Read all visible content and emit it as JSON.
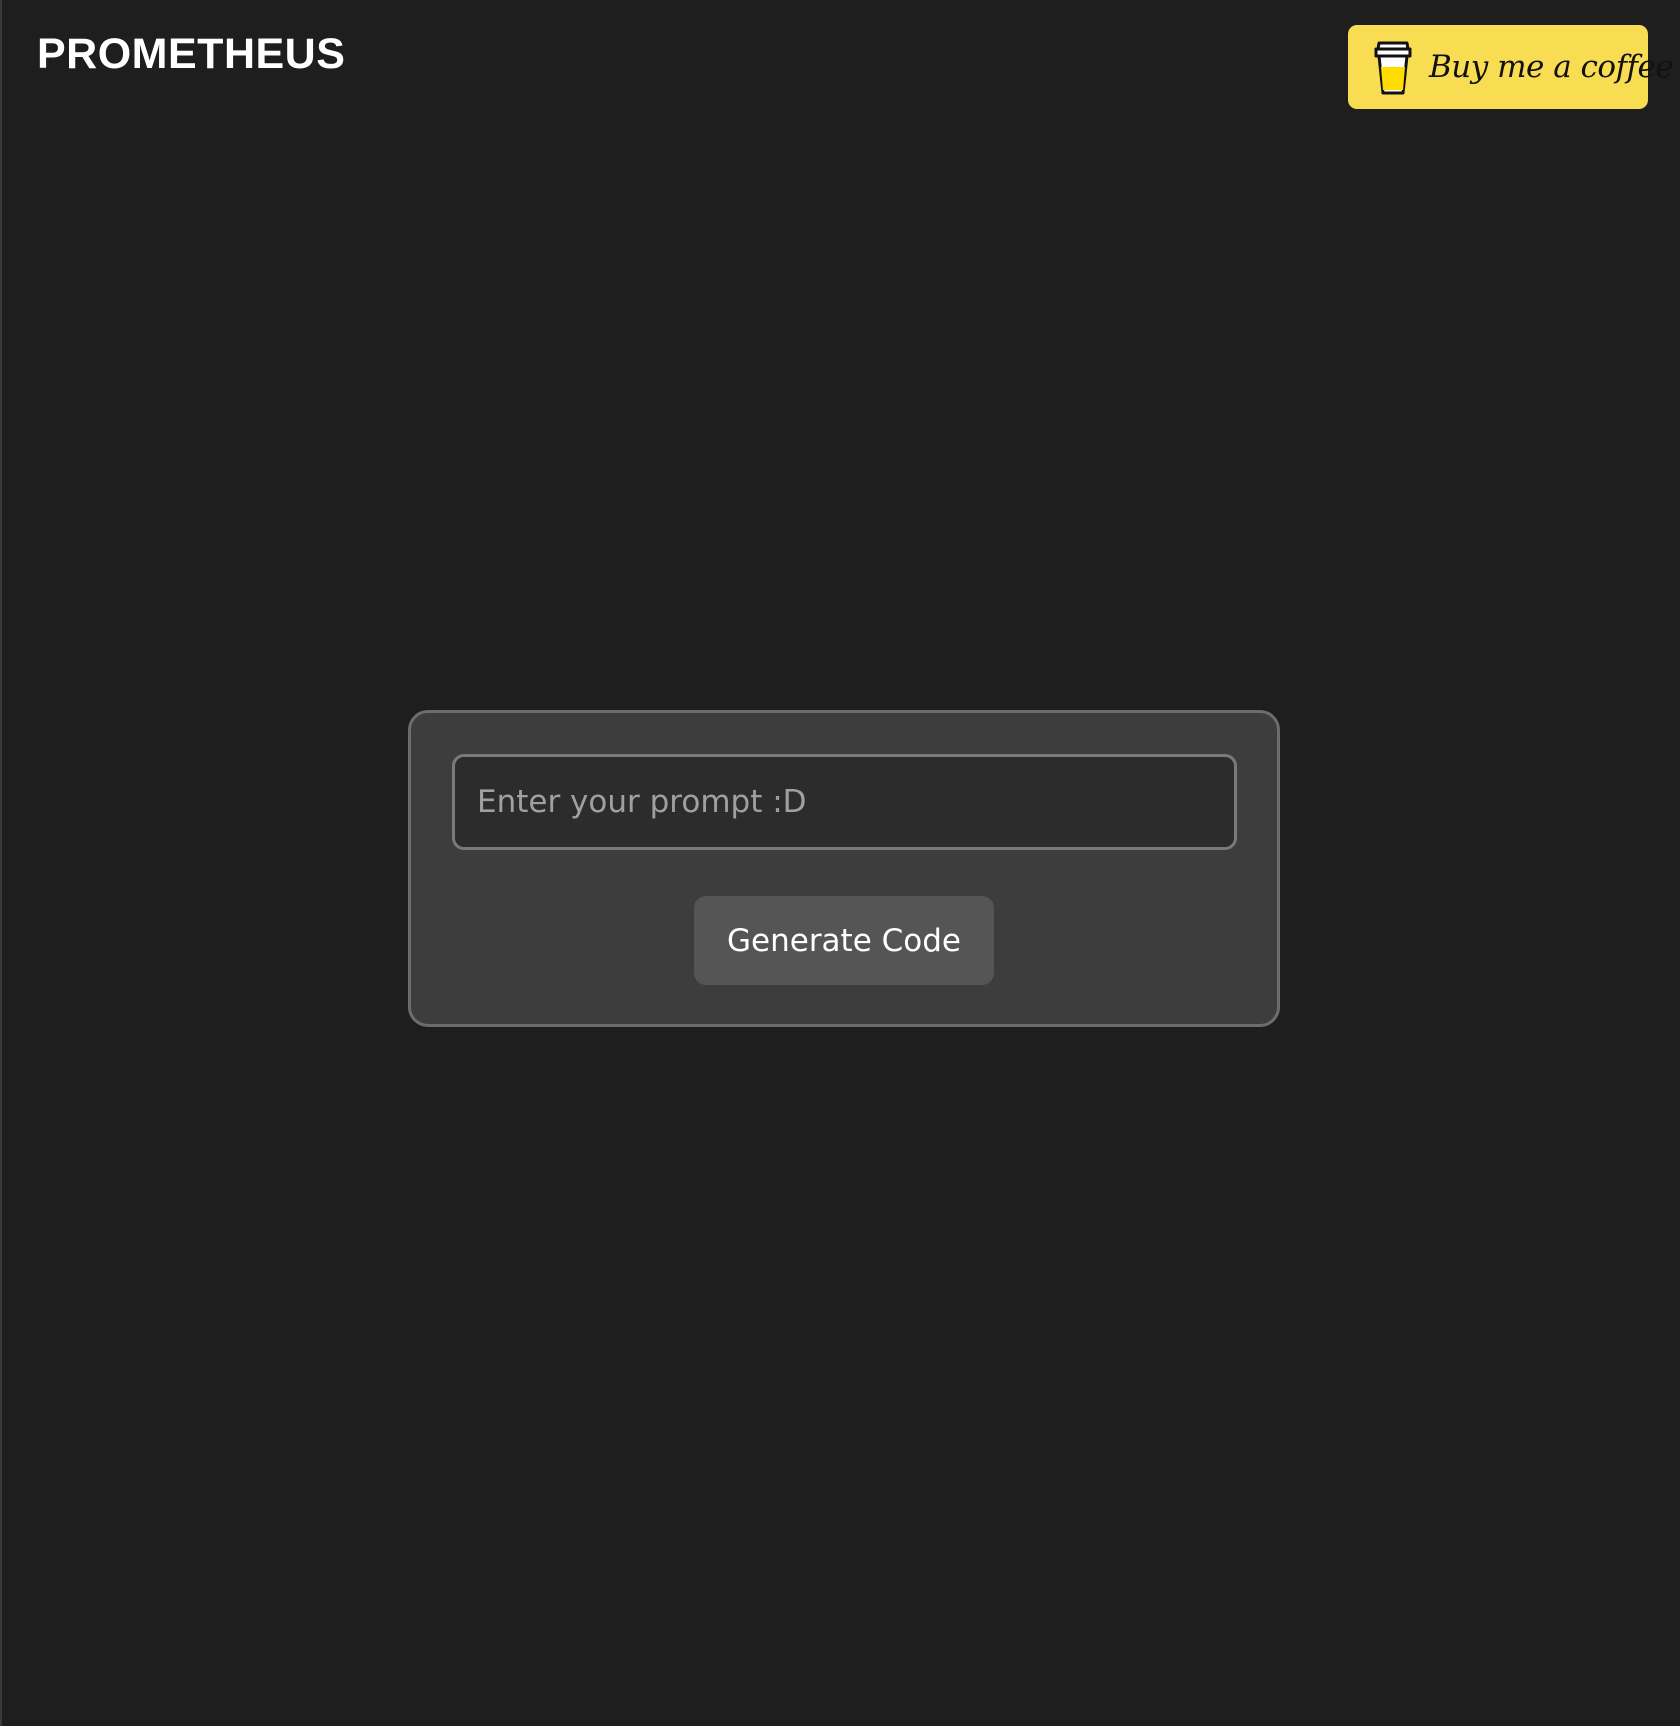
{
  "header": {
    "brand": "PROMETHEUS",
    "coffee_button": {
      "label": "Buy me a coffee",
      "icon": "coffee-cup-icon",
      "background_color": "#f8dd52"
    }
  },
  "main": {
    "prompt_input": {
      "placeholder": "Enter your prompt :D",
      "value": ""
    },
    "generate_button_label": "Generate Code"
  },
  "colors": {
    "page_background": "#1e1e1e",
    "panel_background": "#3d3d3d",
    "button_background": "#555555"
  }
}
